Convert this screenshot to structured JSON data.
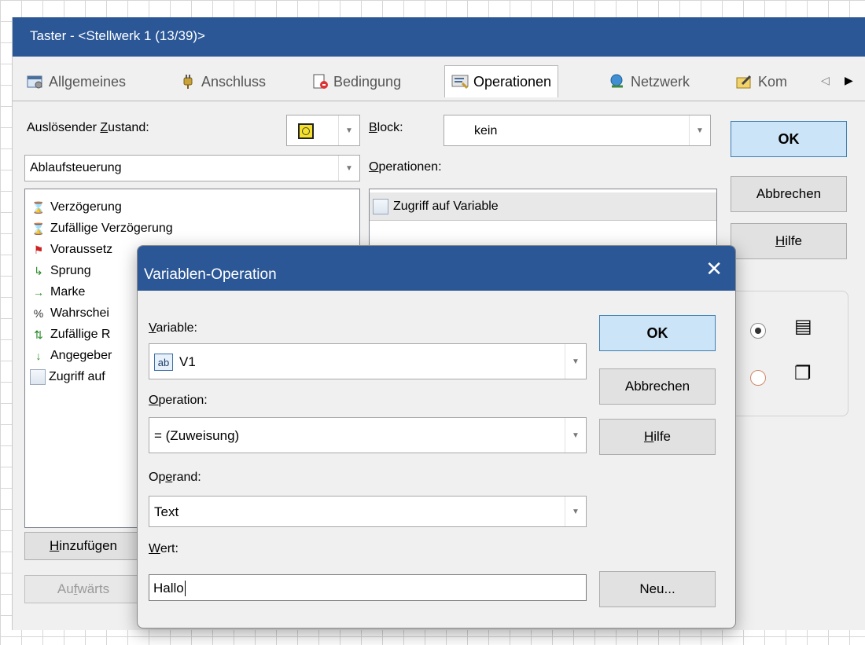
{
  "window": {
    "title": "Taster - <Stellwerk 1 (13/39)>"
  },
  "tabs": [
    {
      "label": "Allgemeines",
      "icon": "settings-window-icon"
    },
    {
      "label": "Anschluss",
      "icon": "plug-icon"
    },
    {
      "label": "Bedingung",
      "icon": "condition-doc-icon"
    },
    {
      "label": "Operationen",
      "icon": "operations-icon"
    },
    {
      "label": "Netzwerk",
      "icon": "network-icon"
    },
    {
      "label": "Kom",
      "icon": "comment-icon"
    }
  ],
  "tab_scroll": {
    "left": "◁",
    "right": "▶"
  },
  "left_panel": {
    "trigger_label_pre": "Auslösender ",
    "trigger_label_u": "Z",
    "trigger_label_post": "ustand:",
    "category_value": "Ablaufsteuerung",
    "items": [
      {
        "label": "Verzögerung",
        "icon": "hourglass-icon"
      },
      {
        "label": "Zufällige Verzögerung",
        "icon": "hourglass-percent-icon"
      },
      {
        "label": "Voraussetz",
        "icon": "flag-question-icon"
      },
      {
        "label": "Sprung",
        "icon": "jump-icon"
      },
      {
        "label": "Marke",
        "icon": "mark-icon"
      },
      {
        "label": "Wahrschei",
        "icon": "percent-icon"
      },
      {
        "label": "Zufällige R",
        "icon": "random-order-icon"
      },
      {
        "label": "Angegeber",
        "icon": "specified-order-icon"
      },
      {
        "label": "Zugriff auf",
        "icon": "variable-access-icon"
      }
    ],
    "add_button_u": "H",
    "add_button_rest": "inzufügen",
    "up_button_pre": "Au",
    "up_button_u": "f",
    "up_button_post": "wärts"
  },
  "middle_panel": {
    "block_label_u": "B",
    "block_label_rest": "lock:",
    "block_value": "kein",
    "operations_label_u": "O",
    "operations_label_rest": "perationen:",
    "operations": [
      {
        "label": "Zugriff auf Variable"
      }
    ]
  },
  "right_buttons": {
    "ok": "OK",
    "cancel": "Abbrechen",
    "help_u": "H",
    "help_rest": "ilfe"
  },
  "dialog": {
    "title": "Variablen-Operation",
    "close_glyph": "✕",
    "variable_label_u": "V",
    "variable_label_rest": "ariable:",
    "variable_value": "V1",
    "variable_icon_text": "ab",
    "operation_label_u": "O",
    "operation_label_rest": "peration:",
    "operation_value": "= (Zuweisung)",
    "operand_label_pre": "Op",
    "operand_label_u": "e",
    "operand_label_post": "rand:",
    "operand_value": "Text",
    "value_label_u": "W",
    "value_label_rest": "ert:",
    "value_input": "Hallo",
    "ok": "OK",
    "cancel": "Abbrechen",
    "help_u": "H",
    "help_rest": "ilfe",
    "new_button": "Neu..."
  }
}
